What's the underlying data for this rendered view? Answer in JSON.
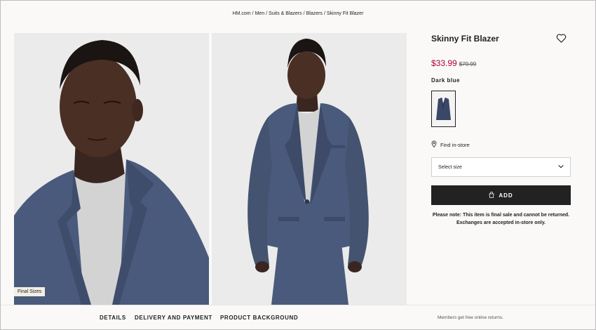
{
  "breadcrumb": [
    "HM.com",
    "Men",
    "Suits & Blazers",
    "Blazers",
    "Skinny Fit Blazer"
  ],
  "gallery": {
    "badge": "Final Sizes",
    "images": [
      "blazer-closeup-photo",
      "blazer-full-photo"
    ]
  },
  "product": {
    "title": "Skinny Fit Blazer",
    "price": "$33.99",
    "old_price": "$79.99",
    "color_name": "Dark blue",
    "find_in_store": "Find in-store",
    "size_placeholder": "Select size",
    "add_label": "ADD",
    "note": "Please note: This item is final sale and cannot be returned. Exchanges are accepted in-store only."
  },
  "bottom": {
    "tabs": [
      "DETAILS",
      "DELIVERY AND PAYMENT",
      "PRODUCT BACKGROUND"
    ],
    "returns": "Members get free online returns."
  },
  "icons": [
    "heart-icon",
    "location-pin-icon",
    "chevron-down-icon",
    "shopping-bag-icon"
  ],
  "colors": {
    "sale_price": "#b3003c",
    "button_bg": "#222222",
    "page_bg": "#faf9f8",
    "badge_bg": "#f2eee6",
    "blazer": "#4a5a7c"
  }
}
